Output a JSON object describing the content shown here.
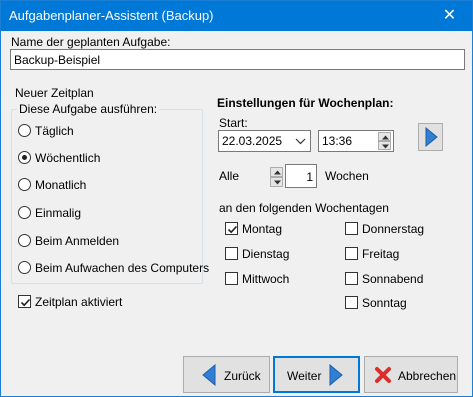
{
  "window": {
    "title": "Aufgabenplaner-Assistent (Backup)",
    "close_glyph": "✕"
  },
  "task_name": {
    "label": "Name der geplanten Aufgabe:",
    "value": "Backup-Beispiel"
  },
  "schedule": {
    "new_schedule_label": "Neuer Zeitplan",
    "group_title": "Diese Aufgabe ausführen:",
    "options": [
      {
        "label": "Täglich",
        "selected": false
      },
      {
        "label": "Wöchentlich",
        "selected": true
      },
      {
        "label": "Monatlich",
        "selected": false
      },
      {
        "label": "Einmalig",
        "selected": false
      },
      {
        "label": "Beim Anmelden",
        "selected": false
      },
      {
        "label": "Beim Aufwachen des Computers",
        "selected": false
      }
    ],
    "enabled_label": "Zeitplan aktiviert",
    "enabled": true
  },
  "weekly": {
    "heading": "Einstellungen für Wochenplan:",
    "start_label": "Start:",
    "start_date": "22.03.2025",
    "start_time": "13:36",
    "every_label": "Alle",
    "every_value": "1",
    "weeks_label": "Wochen",
    "days_label": "an den folgenden Wochentagen",
    "days": [
      {
        "label": "Montag",
        "checked": true
      },
      {
        "label": "Dienstag",
        "checked": false
      },
      {
        "label": "Mittwoch",
        "checked": false
      },
      {
        "label": "Donnerstag",
        "checked": false
      },
      {
        "label": "Freitag",
        "checked": false
      },
      {
        "label": "Sonnabend",
        "checked": false
      },
      {
        "label": "Sonntag",
        "checked": false
      }
    ]
  },
  "buttons": {
    "back": "Zurück",
    "next": "Weiter",
    "cancel": "Abbrechen"
  },
  "colors": {
    "titlebar": "#0078d7",
    "accent_arrow": "#2f7fd4",
    "cancel_red": "#d9302c"
  }
}
